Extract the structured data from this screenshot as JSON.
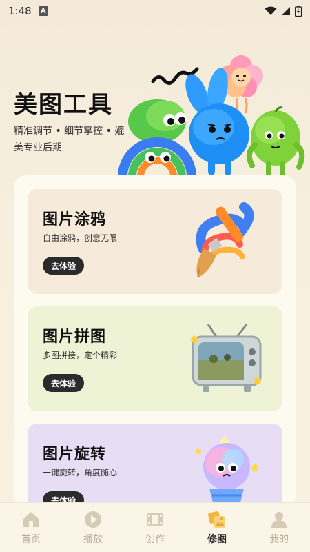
{
  "status_bar": {
    "time": "1:48",
    "badge": "A"
  },
  "hero": {
    "title": "美图工具",
    "subtitle": "精准调节 • 细节掌控 • 媲美专业后期"
  },
  "cards": [
    {
      "title": "图片涂鸦",
      "desc": "自由涂鸦，创意无限",
      "button": "去体验",
      "art_icon": "paintbrush-icon"
    },
    {
      "title": "图片拼图",
      "desc": "多图拼接，定个精彩",
      "button": "去体验",
      "art_icon": "retro-tv-icon"
    },
    {
      "title": "图片旋转",
      "desc": "一键旋转，角度随心",
      "button": "去体验",
      "art_icon": "cute-character-icon"
    }
  ],
  "nav": [
    {
      "label": "首页",
      "icon": "home-icon",
      "active": false
    },
    {
      "label": "播放",
      "icon": "play-icon",
      "active": false
    },
    {
      "label": "创作",
      "icon": "film-icon",
      "active": false
    },
    {
      "label": "修图",
      "icon": "photo-edit-icon",
      "active": true
    },
    {
      "label": "我的",
      "icon": "profile-icon",
      "active": false
    }
  ],
  "colors": {
    "background": "#f6eedd",
    "card1": "#f6ebda",
    "card2": "#eef3d6",
    "card3": "#e7ddf5",
    "button": "#2b2b2b",
    "nav_inactive": "#b9ad98",
    "nav_active": "#e6a93a"
  }
}
